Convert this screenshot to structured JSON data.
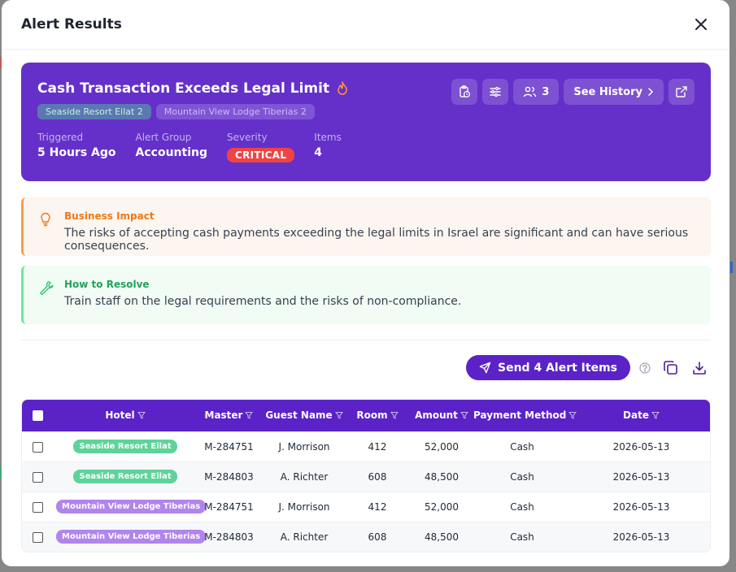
{
  "modal": {
    "title": "Alert Results"
  },
  "alert": {
    "title": "Cash Transaction Exceeds Legal Limit",
    "icon": "fire-icon",
    "chips": [
      "Seaside Resort Eilat 2",
      "Mountain View Lodge Tiberias 2"
    ],
    "meta": [
      {
        "label": "Triggered",
        "value": "5 Hours Ago"
      },
      {
        "label": "Alert Group",
        "value": "Accounting"
      },
      {
        "label": "Severity",
        "value": "CRITICAL"
      },
      {
        "label": "Items",
        "value": "4"
      }
    ],
    "assignee_count": "3",
    "history_label": "See History",
    "colors": {
      "card": "#6530c9",
      "critical": "#ef4444"
    }
  },
  "impact": {
    "title": "Business Impact",
    "text": "The risks of accepting cash payments exceeding the legal limits in Israel are significant and can have serious consequences."
  },
  "resolve": {
    "title": "How to Resolve",
    "text": "Train staff on the legal requirements and the risks of non-compliance."
  },
  "toolbar": {
    "send_label": "Send 4 Alert Items"
  },
  "table": {
    "columns": [
      "Hotel",
      "Master",
      "Guest Name",
      "Room",
      "Amount",
      "Payment Method",
      "Date"
    ],
    "rows": [
      {
        "hotel": "Seaside Resort Eilat",
        "hotel_color": "green",
        "master": "M-284751",
        "guest": "J. Morrison",
        "room": "412",
        "amount": "52,000",
        "method": "Cash",
        "date": "2026-05-13"
      },
      {
        "hotel": "Seaside Resort Eilat",
        "hotel_color": "green",
        "master": "M-284803",
        "guest": "A. Richter",
        "room": "608",
        "amount": "48,500",
        "method": "Cash",
        "date": "2026-05-13"
      },
      {
        "hotel": "Mountain View Lodge Tiberias",
        "hotel_color": "purple",
        "master": "M-284751",
        "guest": "J. Morrison",
        "room": "412",
        "amount": "52,000",
        "method": "Cash",
        "date": "2026-05-13"
      },
      {
        "hotel": "Mountain View Lodge Tiberias",
        "hotel_color": "purple",
        "master": "M-284803",
        "guest": "A. Richter",
        "room": "608",
        "amount": "48,500",
        "method": "Cash",
        "date": "2026-05-13"
      }
    ]
  }
}
